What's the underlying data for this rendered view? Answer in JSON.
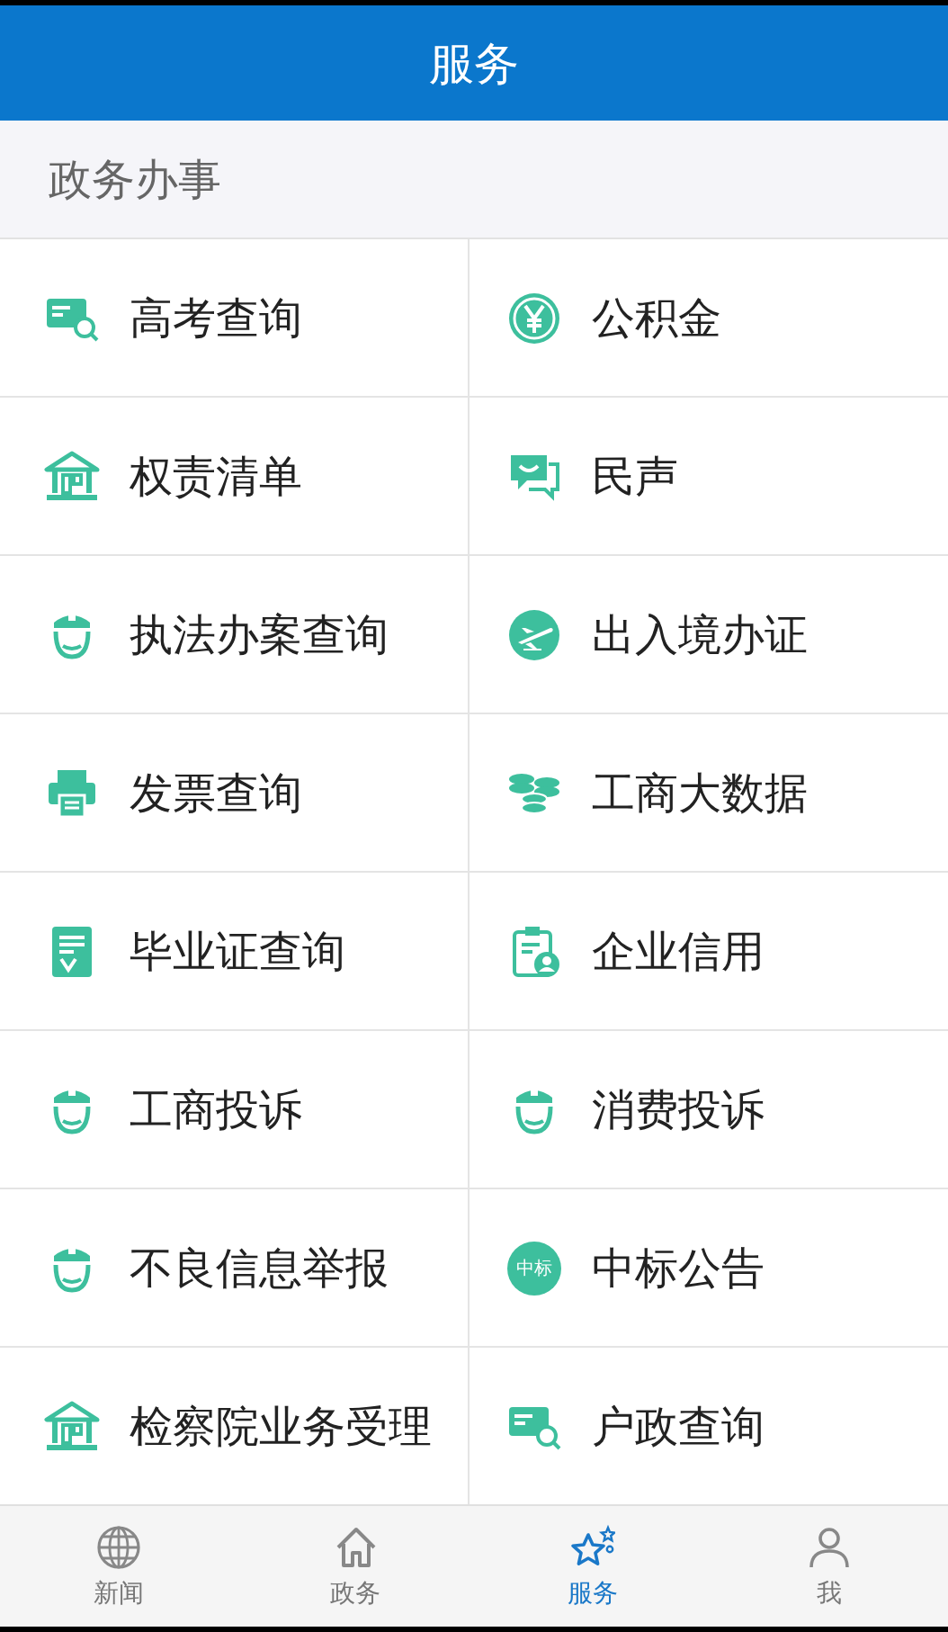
{
  "header": {
    "title": "服务"
  },
  "section": {
    "title": "政务办事"
  },
  "services": [
    {
      "label": "高考查询",
      "kind": "card-search"
    },
    {
      "label": "公积金",
      "kind": "yuan"
    },
    {
      "label": "权责清单",
      "kind": "bank"
    },
    {
      "label": "民声",
      "kind": "chat"
    },
    {
      "label": "执法办案查询",
      "kind": "officer"
    },
    {
      "label": "出入境办证",
      "kind": "plane"
    },
    {
      "label": "发票查询",
      "kind": "printer"
    },
    {
      "label": "工商大数据",
      "kind": "coins"
    },
    {
      "label": "毕业证查询",
      "kind": "document"
    },
    {
      "label": "企业信用",
      "kind": "clipboard"
    },
    {
      "label": "工商投诉",
      "kind": "officer"
    },
    {
      "label": "消费投诉",
      "kind": "officer"
    },
    {
      "label": "不良信息举报",
      "kind": "officer"
    },
    {
      "label": "中标公告",
      "kind": "text-badge",
      "icon_text": "中标"
    },
    {
      "label": "检察院业务受理",
      "kind": "bank"
    },
    {
      "label": "户政查询",
      "kind": "card-search"
    }
  ],
  "tabs": [
    {
      "label": "新闻",
      "kind": "globe",
      "selected": false
    },
    {
      "label": "政务",
      "kind": "house",
      "selected": false
    },
    {
      "label": "服务",
      "kind": "stars",
      "selected": true
    },
    {
      "label": "我",
      "kind": "person",
      "selected": false
    }
  ]
}
